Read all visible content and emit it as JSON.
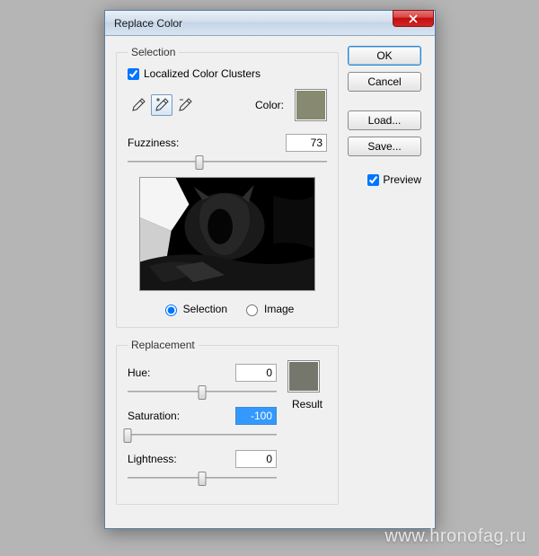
{
  "dialog": {
    "title": "Replace Color"
  },
  "selection": {
    "legend": "Selection",
    "localized_label": "Localized Color Clusters",
    "localized_checked": true,
    "color_label": "Color:",
    "color_hex": "#878971",
    "fuzziness_label": "Fuzziness:",
    "fuzziness_value": "73",
    "fuzziness_percent": 36,
    "radio_selection": "Selection",
    "radio_image": "Image",
    "radio_selected": "selection"
  },
  "replacement": {
    "legend": "Replacement",
    "hue_label": "Hue:",
    "hue_value": "0",
    "hue_percent": 50,
    "sat_label": "Saturation:",
    "sat_value": "-100",
    "sat_percent": 0,
    "light_label": "Lightness:",
    "light_value": "0",
    "light_percent": 50,
    "result_label": "Result",
    "result_hex": "#76776c"
  },
  "buttons": {
    "ok": "OK",
    "cancel": "Cancel",
    "load": "Load...",
    "save": "Save...",
    "preview_label": "Preview",
    "preview_checked": true
  },
  "tools": {
    "eyedropper": "eyedropper-icon",
    "eyedropper_add": "eyedropper-add-icon",
    "eyedropper_sub": "eyedropper-sub-icon",
    "active": "add"
  },
  "watermark": "www.hronofag.ru"
}
